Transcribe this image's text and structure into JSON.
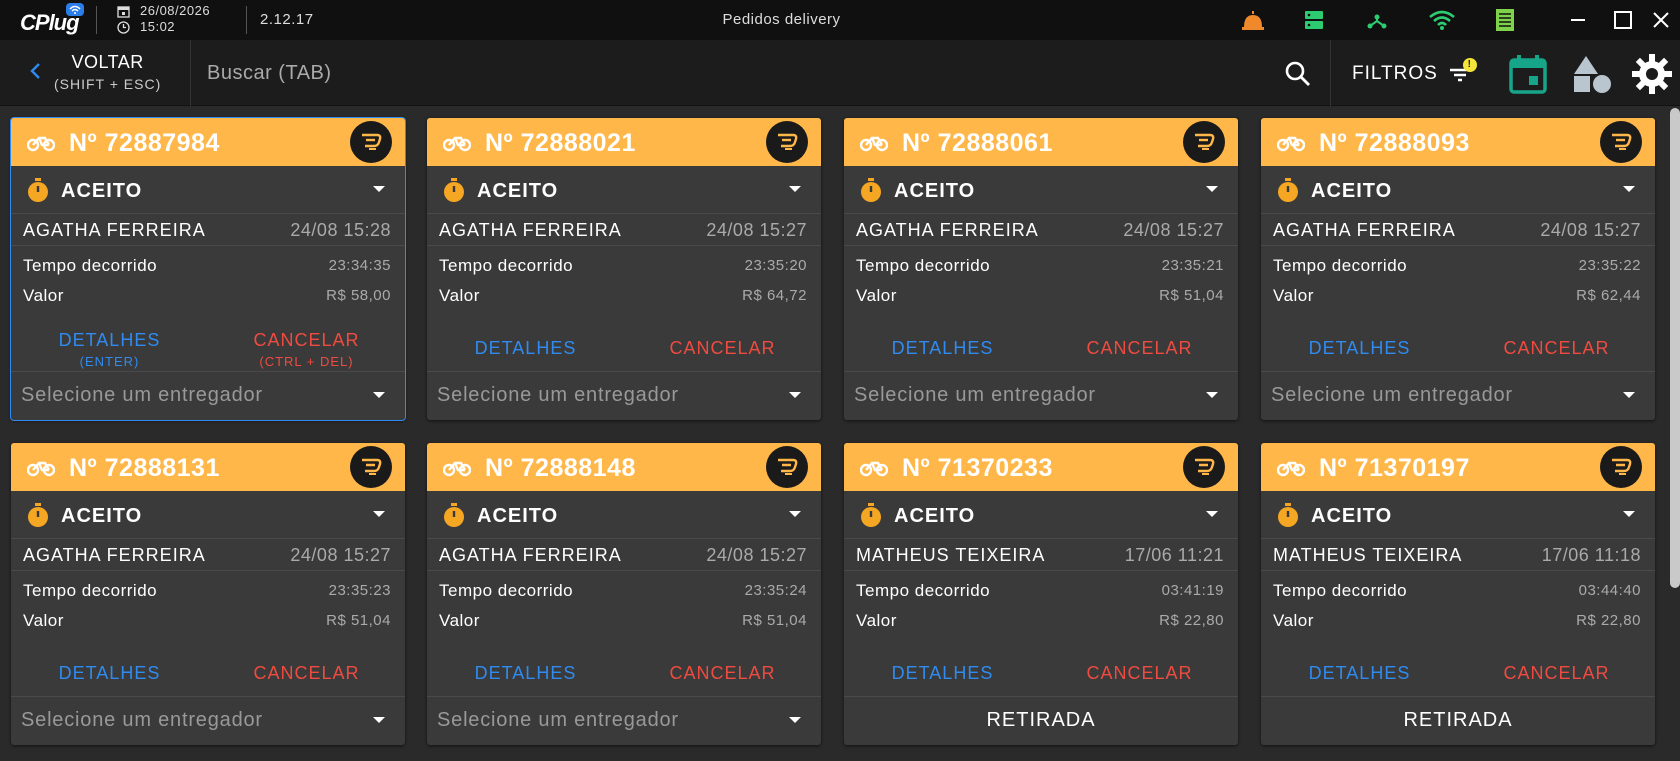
{
  "app": {
    "logo_text": "Plug",
    "logo_prefix": "C",
    "date": "26/08/2026",
    "time": "15:02",
    "version": "2.12.17",
    "window_title": "Pedidos delivery"
  },
  "toolbar": {
    "back_label": "VOLTAR",
    "back_shortcut": "(SHIFT + ESC)",
    "search_placeholder": "Buscar (TAB)",
    "filters_label": "FILTROS",
    "filters_badge": "!"
  },
  "colors": {
    "accent_header": "#ffb74a",
    "details": "#2f8bf0",
    "cancel": "#ef4b40",
    "calendar": "#17a589"
  },
  "orders": [
    {
      "number": "Nº 72887984",
      "status": "ACEITO",
      "client": "AGATHA FERREIRA",
      "datetime": "24/08 15:28",
      "elapsed_label": "Tempo decorrido",
      "elapsed": "23:34:35",
      "value_label": "Valor",
      "value": "R$ 58,00",
      "details": "DETALHES",
      "details_hint": "(ENTER)",
      "cancel": "CANCELAR",
      "cancel_hint": "(CTRL + DEL)",
      "courier": "Selecione um entregador",
      "pickup": ""
    },
    {
      "number": "Nº 72888021",
      "status": "ACEITO",
      "client": "AGATHA FERREIRA",
      "datetime": "24/08 15:27",
      "elapsed_label": "Tempo decorrido",
      "elapsed": "23:35:20",
      "value_label": "Valor",
      "value": "R$ 64,72",
      "details": "DETALHES",
      "details_hint": "",
      "cancel": "CANCELAR",
      "cancel_hint": "",
      "courier": "Selecione um entregador",
      "pickup": ""
    },
    {
      "number": "Nº 72888061",
      "status": "ACEITO",
      "client": "AGATHA FERREIRA",
      "datetime": "24/08 15:27",
      "elapsed_label": "Tempo decorrido",
      "elapsed": "23:35:21",
      "value_label": "Valor",
      "value": "R$ 51,04",
      "details": "DETALHES",
      "details_hint": "",
      "cancel": "CANCELAR",
      "cancel_hint": "",
      "courier": "Selecione um entregador",
      "pickup": ""
    },
    {
      "number": "Nº 72888093",
      "status": "ACEITO",
      "client": "AGATHA FERREIRA",
      "datetime": "24/08 15:27",
      "elapsed_label": "Tempo decorrido",
      "elapsed": "23:35:22",
      "value_label": "Valor",
      "value": "R$ 62,44",
      "details": "DETALHES",
      "details_hint": "",
      "cancel": "CANCELAR",
      "cancel_hint": "",
      "courier": "Selecione um entregador",
      "pickup": ""
    },
    {
      "number": "Nº 72888131",
      "status": "ACEITO",
      "client": "AGATHA FERREIRA",
      "datetime": "24/08 15:27",
      "elapsed_label": "Tempo decorrido",
      "elapsed": "23:35:23",
      "value_label": "Valor",
      "value": "R$ 51,04",
      "details": "DETALHES",
      "details_hint": "",
      "cancel": "CANCELAR",
      "cancel_hint": "",
      "courier": "Selecione um entregador",
      "pickup": ""
    },
    {
      "number": "Nº 72888148",
      "status": "ACEITO",
      "client": "AGATHA FERREIRA",
      "datetime": "24/08 15:27",
      "elapsed_label": "Tempo decorrido",
      "elapsed": "23:35:24",
      "value_label": "Valor",
      "value": "R$ 51,04",
      "details": "DETALHES",
      "details_hint": "",
      "cancel": "CANCELAR",
      "cancel_hint": "",
      "courier": "Selecione um entregador",
      "pickup": ""
    },
    {
      "number": "Nº 71370233",
      "status": "ACEITO",
      "client": "MATHEUS TEIXEIRA",
      "datetime": "17/06 11:21",
      "elapsed_label": "Tempo decorrido",
      "elapsed": "03:41:19",
      "value_label": "Valor",
      "value": "R$ 22,80",
      "details": "DETALHES",
      "details_hint": "",
      "cancel": "CANCELAR",
      "cancel_hint": "",
      "courier": "",
      "pickup": "RETIRADA"
    },
    {
      "number": "Nº 71370197",
      "status": "ACEITO",
      "client": "MATHEUS TEIXEIRA",
      "datetime": "17/06 11:18",
      "elapsed_label": "Tempo decorrido",
      "elapsed": "03:44:40",
      "value_label": "Valor",
      "value": "R$ 22,80",
      "details": "DETALHES",
      "details_hint": "",
      "cancel": "CANCELAR",
      "cancel_hint": "",
      "courier": "",
      "pickup": "RETIRADA"
    }
  ]
}
